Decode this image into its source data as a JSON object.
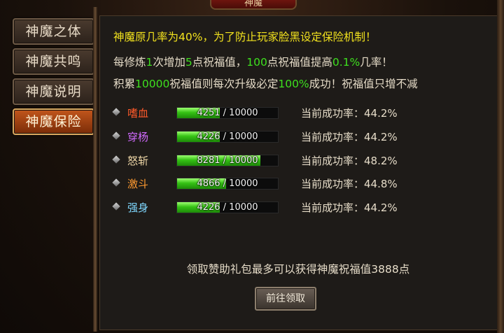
{
  "window": {
    "title": "神魔"
  },
  "sidebar": {
    "tabs": [
      {
        "label": "神魔之体"
      },
      {
        "label": "神魔共鸣"
      },
      {
        "label": "神魔说明"
      },
      {
        "label": "神魔保险",
        "active": true
      }
    ]
  },
  "info": {
    "line1": "神魔原几率为40%，为了防止玩家脸黑设定保险机制！",
    "line2": {
      "p1": "每修炼",
      "n1": "1",
      "p2": "次增加",
      "n2": "5",
      "p3": "点祝福值，",
      "n3": "100",
      "p4": "点祝福值提高",
      "n4": "0.1%",
      "p5": "几率！"
    },
    "line3": {
      "p1": "积累",
      "n1": "10000",
      "p2": "祝福值则每次升级必定",
      "n2": "100%",
      "p3": "成功！祝福值只增不减"
    }
  },
  "attributes": [
    {
      "name": "嗜血",
      "color": "#ff5a2a",
      "current": 4251,
      "max": 10000,
      "progress_text": "4251 / 10000",
      "rate": "当前成功率：44.2%"
    },
    {
      "name": "穿杨",
      "color": "#d26bff",
      "current": 4226,
      "max": 10000,
      "progress_text": "4226 / 10000",
      "rate": "当前成功率：44.2%"
    },
    {
      "name": "怒斩",
      "color": "#f0d8a8",
      "current": 8281,
      "max": 10000,
      "progress_text": "8281 / 10000",
      "rate": "当前成功率：48.2%"
    },
    {
      "name": "激斗",
      "color": "#ff9a30",
      "current": 4866,
      "max": 10000,
      "progress_text": "4866 / 10000",
      "rate": "当前成功率：44.8%"
    },
    {
      "name": "强身",
      "color": "#7fd8ff",
      "current": 4226,
      "max": 10000,
      "progress_text": "4226 / 10000",
      "rate": "当前成功率：44.2%"
    }
  ],
  "footer": {
    "note": "领取赞助礼包最多可以获得神魔祝福值3888点",
    "button_label": "前往领取"
  }
}
